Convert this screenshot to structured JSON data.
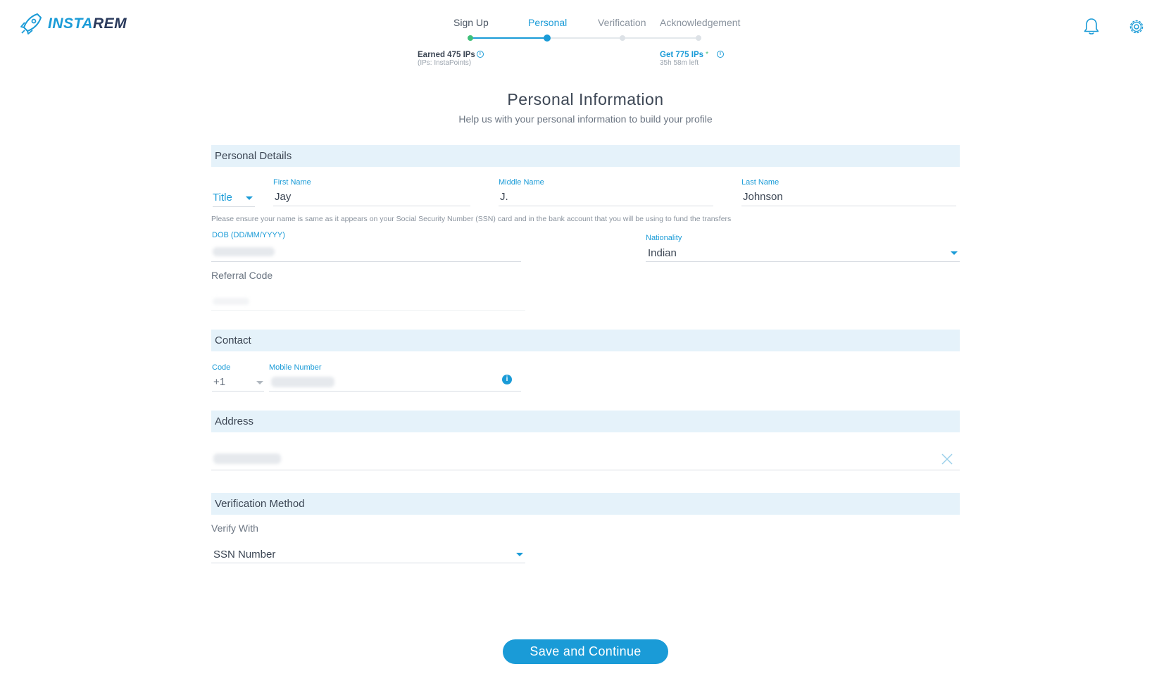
{
  "brand": {
    "name_part1": "INSTA",
    "name_part2": "REM"
  },
  "header": {
    "icons": [
      "bell-icon",
      "gear-icon"
    ]
  },
  "stepper": {
    "steps": [
      {
        "label": "Sign Up",
        "state": "done"
      },
      {
        "label": "Personal",
        "state": "active"
      },
      {
        "label": "Verification",
        "state": "pending"
      },
      {
        "label": "Acknowledgement",
        "state": "pending"
      }
    ],
    "earned": {
      "text": "Earned 475 IPs",
      "sub": "(IPs: InstaPoints)"
    },
    "reward": {
      "text": "Get 775 IPs",
      "star": "*",
      "sub": "35h 58m left"
    }
  },
  "page": {
    "title": "Personal Information",
    "subtitle": "Help us with your personal information to build your profile"
  },
  "personal_details": {
    "heading": "Personal Details",
    "title_select": {
      "value": "Title"
    },
    "first_name": {
      "label": "First Name",
      "value": "Jay"
    },
    "middle_name": {
      "label": "Middle Name",
      "value": "J."
    },
    "last_name": {
      "label": "Last Name",
      "value": "Johnson"
    },
    "name_hint": "Please ensure your name is same as it appears on your Social Security Number (SSN) card and in the bank account that you will be using to fund the transfers",
    "dob": {
      "label": "DOB (DD/MM/YYYY)"
    },
    "nationality": {
      "label": "Nationality",
      "value": "Indian"
    },
    "referral": {
      "label": "Referral Code"
    }
  },
  "contact": {
    "heading": "Contact",
    "code": {
      "label": "Code",
      "value": "+1"
    },
    "mobile": {
      "label": "Mobile Number"
    }
  },
  "address": {
    "heading": "Address"
  },
  "verification": {
    "heading": "Verification Method",
    "verify_label": "Verify With",
    "method": {
      "value": "SSN Number"
    }
  },
  "actions": {
    "save_label": "Save and Continue"
  },
  "colors": {
    "accent": "#1a9bd7",
    "success": "#3fbf7a",
    "section_bg": "#e5f2fa",
    "brand_dark": "#2a3a5c"
  }
}
